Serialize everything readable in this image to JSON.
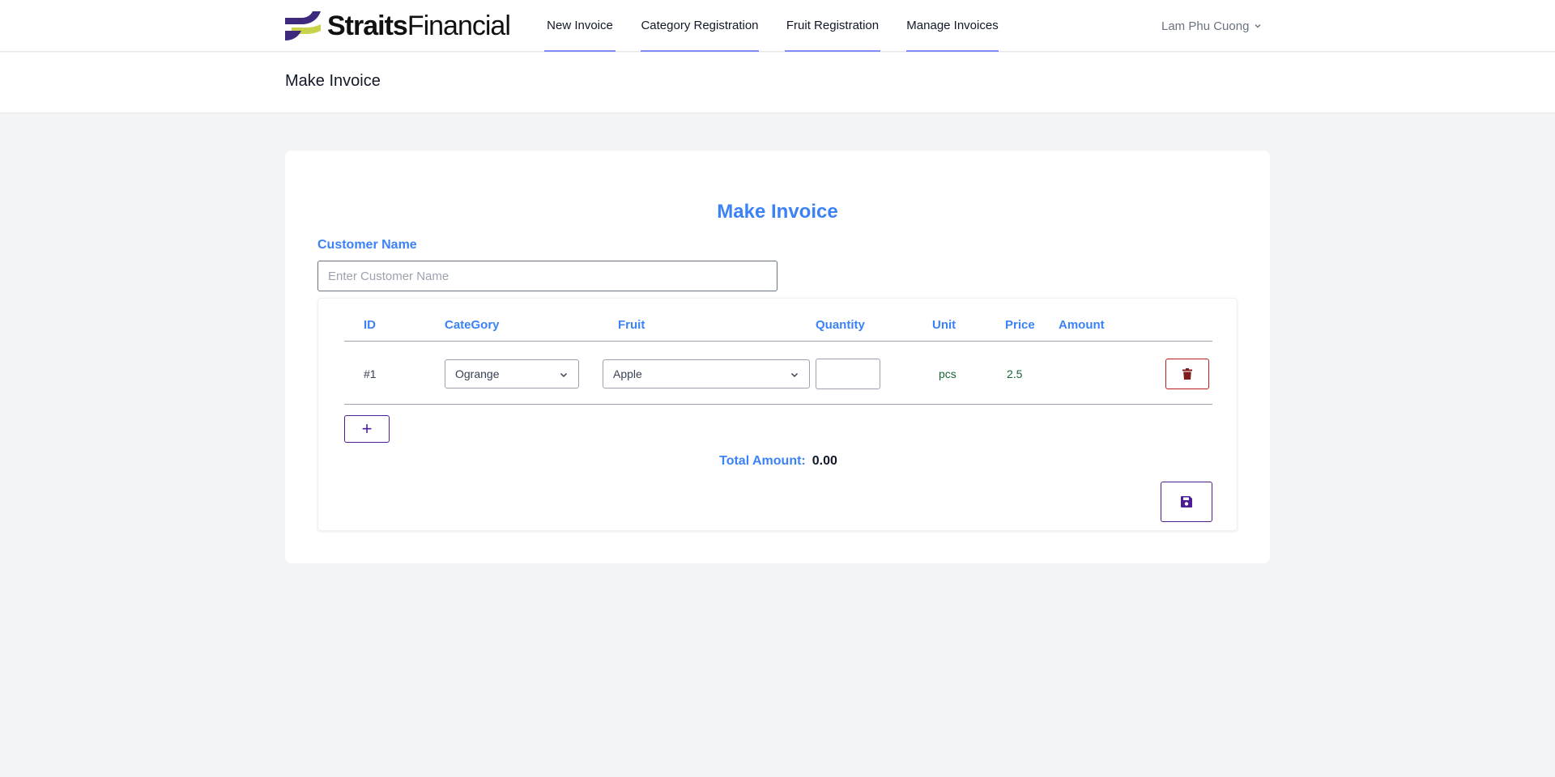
{
  "nav": {
    "logo_text_bold": "Straits",
    "logo_text_light": "Financial",
    "links": [
      "New Invoice",
      "Category Registration",
      "Fruit Registration",
      "Manage Invoices"
    ],
    "user_name": "Lam Phu Cuong",
    "user_icon": "chevron-down-icon"
  },
  "page_header": {
    "title": "Make Invoice"
  },
  "form": {
    "title": "Make Invoice",
    "customer_label": "Customer Name",
    "customer_placeholder": "Enter Customer Name",
    "customer_value": ""
  },
  "table": {
    "headers": [
      "ID",
      "CateGory",
      "Fruit",
      "Quantity",
      "Unit",
      "Price",
      "Amount"
    ],
    "rows": [
      {
        "id": "#1",
        "category": "Ograngе",
        "fruit": "Apple",
        "quantity": "",
        "unit": "pcs",
        "price": "2.5",
        "amount": "",
        "delete_icon": "trash-icon"
      }
    ]
  },
  "actions": {
    "add_label": "+",
    "save_icon": "floppy-disk-icon"
  },
  "total": {
    "label": "Total Amount:",
    "value": "0.00"
  },
  "colors": {
    "accent": "#3b82f6",
    "nav_underline": "#818cf8",
    "danger": "#b91c1c",
    "primary_dark": "#4c1d95",
    "logo_purple": "#3d2a7d",
    "logo_yellow": "#c8d24a",
    "background": "#f3f4f6"
  }
}
